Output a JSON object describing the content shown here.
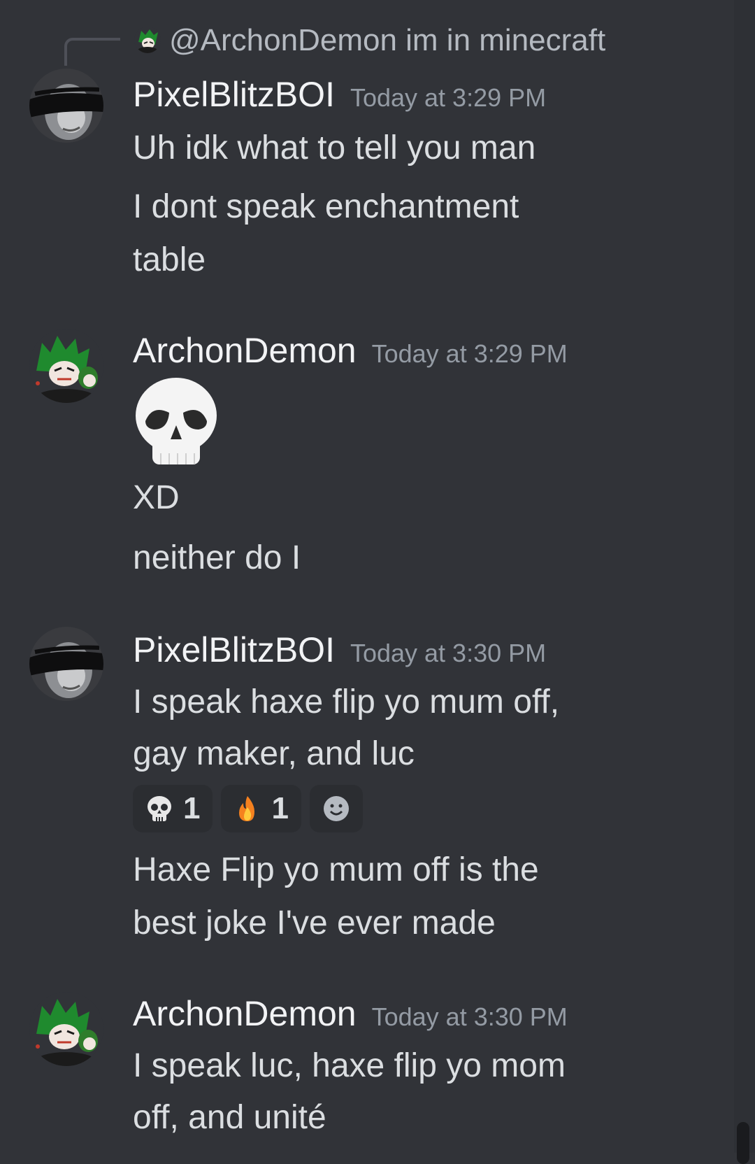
{
  "reply": {
    "mention": "@ArchonDemon",
    "text": "im in minecraft"
  },
  "messages": [
    {
      "username": "PixelBlitzBOI",
      "timestamp": "Today at 3:29 PM",
      "lines": [
        "Uh idk what to tell you man",
        "I dont speak enchantment",
        "table"
      ]
    },
    {
      "username": "ArchonDemon",
      "timestamp": "Today at 3:29 PM",
      "emoji": "skull",
      "lines": [
        "XD",
        "neither do I"
      ]
    },
    {
      "username": "PixelBlitzBOI",
      "timestamp": "Today at 3:30 PM",
      "lines": [
        "I speak haxe flip yo mum off,",
        "gay maker, and luc",
        "Haxe Flip yo mum off is the",
        "best joke I've ever made"
      ],
      "reactions": [
        {
          "emoji": "skull-icon",
          "count": "1"
        },
        {
          "emoji": "fire-icon",
          "count": "1"
        }
      ]
    },
    {
      "username": "ArchonDemon",
      "timestamp": "Today at 3:30 PM",
      "lines": [
        "I speak luc, haxe flip yo mom",
        "off, and unité"
      ]
    }
  ],
  "colors": {
    "background": "#313338",
    "username": "#f2f3f5",
    "timestamp": "#949ba4",
    "text": "#dbdee1",
    "reaction_bg": "#2b2d31"
  }
}
